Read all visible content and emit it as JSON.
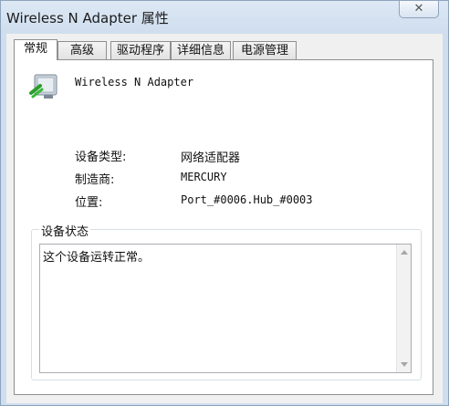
{
  "window": {
    "title": "Wireless N Adapter 属性",
    "close": "✕"
  },
  "tabs": [
    {
      "label": "常规"
    },
    {
      "label": "高级"
    },
    {
      "label": "驱动程序"
    },
    {
      "label": "详细信息"
    },
    {
      "label": "电源管理"
    }
  ],
  "general": {
    "device_name": "Wireless N Adapter",
    "device_icon": "network-adapter-icon",
    "props": [
      {
        "label": "设备类型:",
        "value": "网络适配器"
      },
      {
        "label": "制造商:",
        "value": "MERCURY"
      },
      {
        "label": "位置:",
        "value": "Port_#0006.Hub_#0003"
      }
    ],
    "status_group": {
      "title": "设备状态",
      "text": "这个设备运转正常。"
    }
  },
  "colors": {
    "highlight_underline": "#d4141b"
  }
}
